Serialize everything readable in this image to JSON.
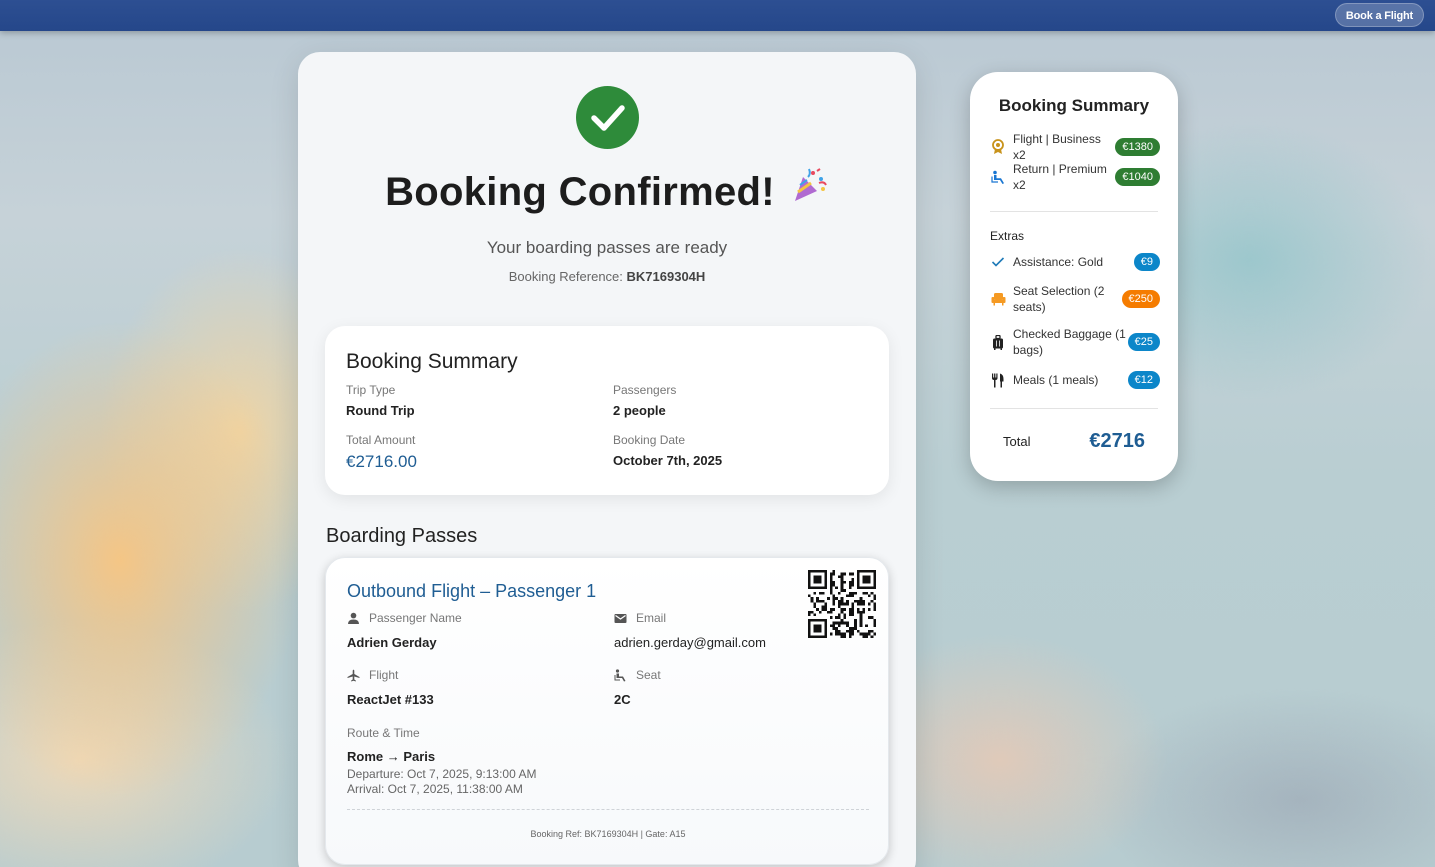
{
  "topbar": {
    "book_flight_label": "Book a Flight"
  },
  "confirmation": {
    "title": "Booking Confirmed!",
    "subtitle": "Your boarding passes are ready",
    "reference_label": "Booking Reference:",
    "reference_value": "BK7169304H"
  },
  "summary": {
    "title": "Booking Summary",
    "trip_type_label": "Trip Type",
    "trip_type_value": "Round Trip",
    "passengers_label": "Passengers",
    "passengers_value": "2 people",
    "total_label": "Total Amount",
    "total_value": "€2716.00",
    "date_label": "Booking Date",
    "date_value": "October 7th, 2025"
  },
  "boarding": {
    "section_title": "Boarding Passes",
    "pass": {
      "title": "Outbound Flight – Passenger 1",
      "name_label": "Passenger Name",
      "name_value": "Adrien Gerday",
      "email_label": "Email",
      "email_value": "adrien.gerday@gmail.com",
      "flight_label": "Flight",
      "flight_value": "ReactJet #133",
      "seat_label": "Seat",
      "seat_value": "2C",
      "route_label": "Route & Time",
      "route_value": "Rome → Paris",
      "departure": "Departure: Oct 7, 2025, 9:13:00 AM",
      "arrival": "Arrival: Oct 7, 2025, 11:38:00 AM",
      "footer": "Booking Ref: BK7169304H | Gate: A15"
    }
  },
  "side": {
    "title": "Booking Summary",
    "flights": [
      {
        "icon": "award-icon",
        "text": "Flight | Business x2",
        "price": "€1380"
      },
      {
        "icon": "seat-recline-icon",
        "text": "Return | Premium x2",
        "price": "€1040"
      }
    ],
    "extras_label": "Extras",
    "extras": [
      {
        "icon": "check-icon",
        "text": "Assistance: Gold",
        "price": "€9",
        "color": "#0c86c9"
      },
      {
        "icon": "armchair-icon",
        "text": "Seat Selection (2 seats)",
        "price": "€250",
        "color": "#f57c00"
      },
      {
        "icon": "luggage-icon",
        "text": "Checked Baggage (1 bags)",
        "price": "€25",
        "color": "#0c86c9"
      },
      {
        "icon": "utensils-icon",
        "text": "Meals (1 meals)",
        "price": "€12",
        "color": "#0c86c9"
      }
    ],
    "total_label": "Total",
    "total_value": "€2716"
  },
  "colors": {
    "topbar": "#2d4f92",
    "success": "#2e8b3a",
    "accent": "#1f5d93",
    "badge_green": "#2e7d32",
    "badge_blue": "#0c86c9",
    "badge_orange": "#f57c00"
  }
}
